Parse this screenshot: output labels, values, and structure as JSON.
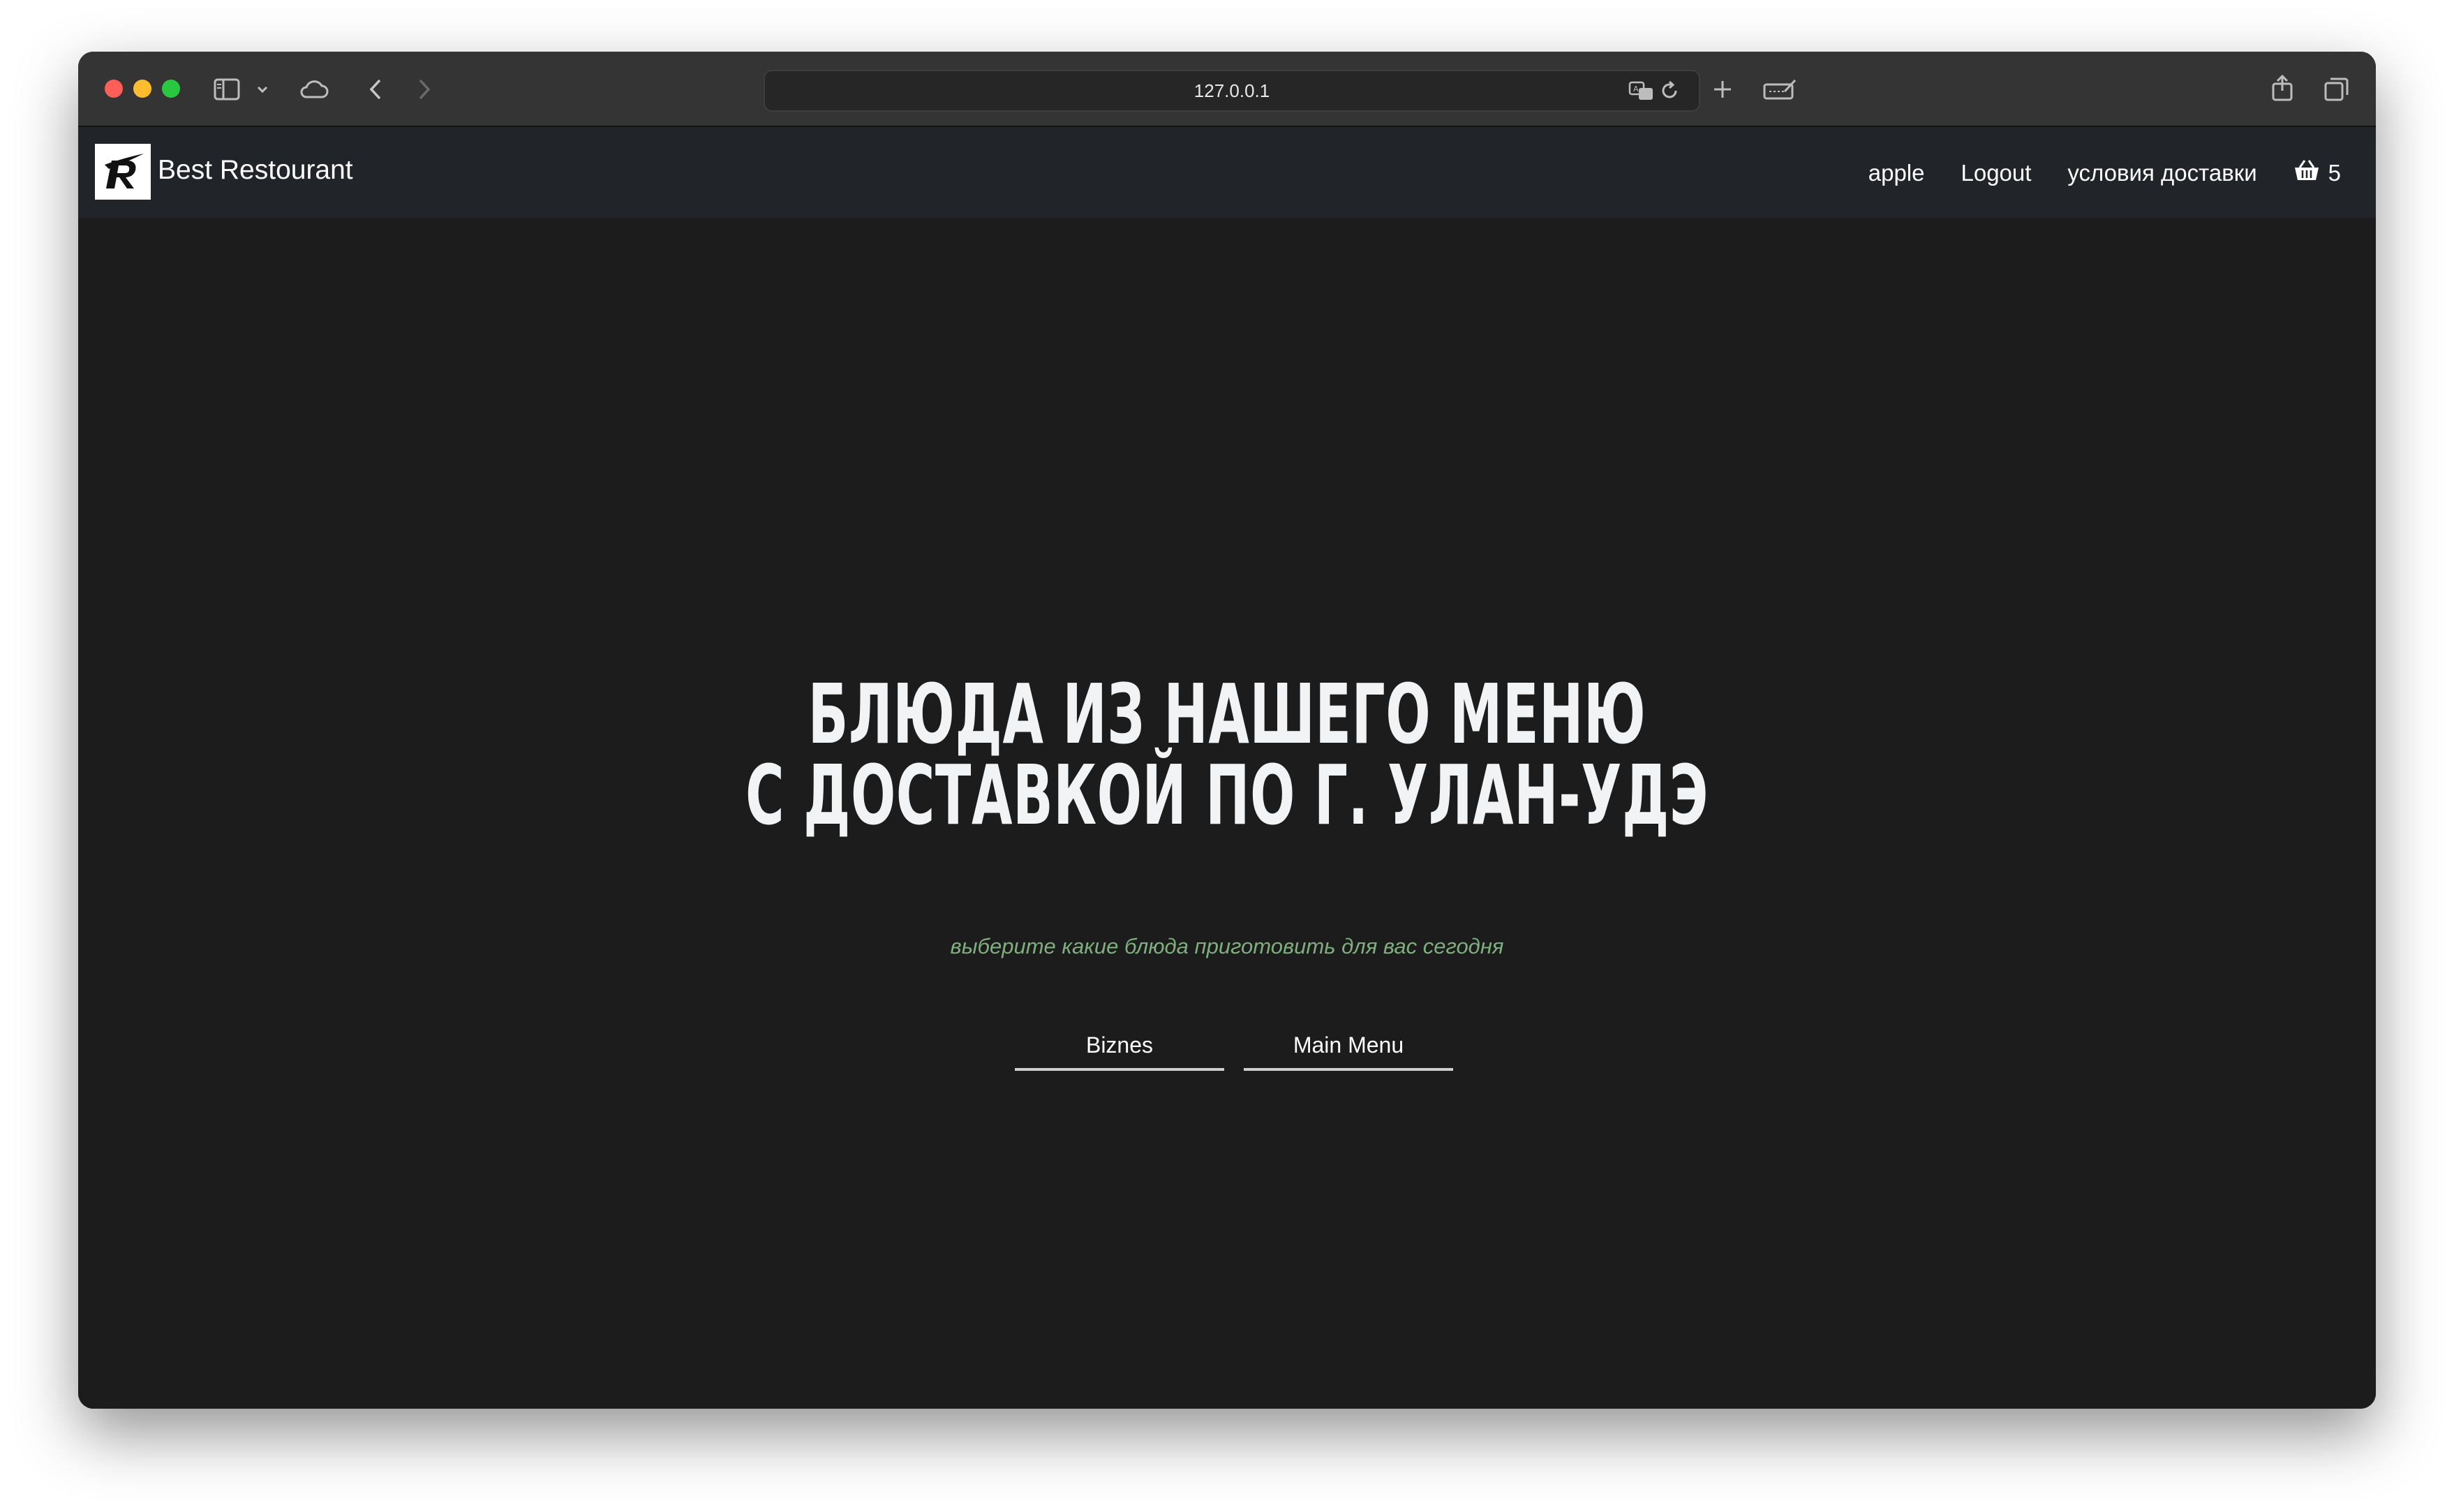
{
  "browser": {
    "url": "127.0.0.1",
    "icons": [
      "sidebar-icon",
      "chevron-down-icon",
      "cloud-icon",
      "back-icon",
      "forward-icon",
      "translate-icon",
      "reload-icon",
      "new-tab-icon",
      "edit-icon",
      "share-icon",
      "tabs-icon"
    ]
  },
  "navbar": {
    "brand": "Best Restourant",
    "links": {
      "user": "apple",
      "logout": "Logout",
      "delivery": "условия доставки"
    },
    "cart_count": "5",
    "cart_icon": "basket-icon",
    "logo_icon": "r-logo-icon"
  },
  "hero": {
    "title_line1": "БЛЮДА ИЗ НАШЕГО МЕНЮ",
    "title_line2": "С ДОСТАВКОЙ ПО Г. УЛАН-УДЭ",
    "subtitle": "выберите какие блюда приготовить для вас сегодня",
    "buttons": {
      "biznes": "Biznes",
      "main_menu": "Main Menu"
    }
  },
  "colors": {
    "navbar_bg": "#212529",
    "hero_bg": "#1c1c1c",
    "subtitle": "#7fae7f"
  }
}
